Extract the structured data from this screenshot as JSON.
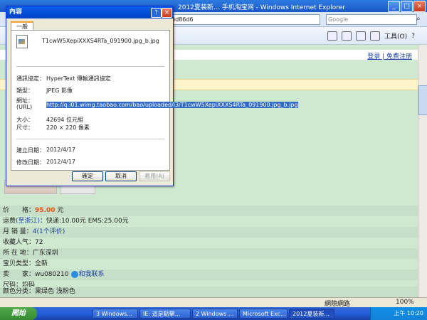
{
  "ie": {
    "title": "2012夏装新… 手机淘宝网 - Windows Internet Explorer",
    "address": "93821c830d86d6",
    "search_placeholder": "Google",
    "tools_label": "工具(O)",
    "login": "登录",
    "register": "免费注册",
    "status_zone": "網際網路",
    "zoom": "100%"
  },
  "product": {
    "price_label": "价　　格：",
    "price_value": "95.00",
    "price_unit": "元",
    "shipping_label": "运费",
    "shipping_region": "(至浙江)",
    "shipping_value": "：快递:10.00元 EMS:25.00元",
    "sales_label": "月 销 量：",
    "sales_value": "4(1个评价)",
    "fav_label": "收藏人气：",
    "fav_value": "72",
    "loc_label": "所 在 地：",
    "loc_value": "广东深圳",
    "type_label": "宝贝类型：",
    "type_value": "全新",
    "seller_label": "卖　　家：",
    "seller_value": "wu080210",
    "chat_label": "和我联系",
    "size_label": "尺码：",
    "size_value": "均码",
    "color_label": "颜色分类：",
    "color_value": "果绿色 浅粉色"
  },
  "dialog": {
    "title": "內容",
    "help_icon": "?",
    "close_icon": "×",
    "tab": "一般",
    "file_name": "T1cwW5XepiXXXS4RTa_091900.jpg_b.jpg",
    "protocol_key": "通訊協定：",
    "protocol_val": "HyperText 傳輸通訊協定",
    "type_key": "類型：",
    "type_val": "JPEG 影像",
    "url_key": "網址：",
    "url_key2": "(URL)",
    "url_val": "http://q.i01.wimg.taobao.com/bao/uploaded/i3/T1cwW5XepiXXXS4RTa_091900.jpg_b.jpg",
    "size_key": "大小：",
    "size_val": "42694 位元組",
    "dim_key": "尺寸：",
    "dim_val": "220 × 220 像素",
    "created_key": "建立日期：",
    "created_val": "2012/4/17",
    "modified_key": "修改日期：",
    "modified_val": "2012/4/17",
    "ok": "確定",
    "cancel": "取消",
    "apply": "套用(A)"
  },
  "taskbar": {
    "start": "開始",
    "tasks": [
      "3 Windows...",
      "IE: 這是點擊...",
      "2 Windows ...",
      "Microsoft Exc...",
      "2012夏装新..."
    ],
    "time": "上午 10:20"
  }
}
